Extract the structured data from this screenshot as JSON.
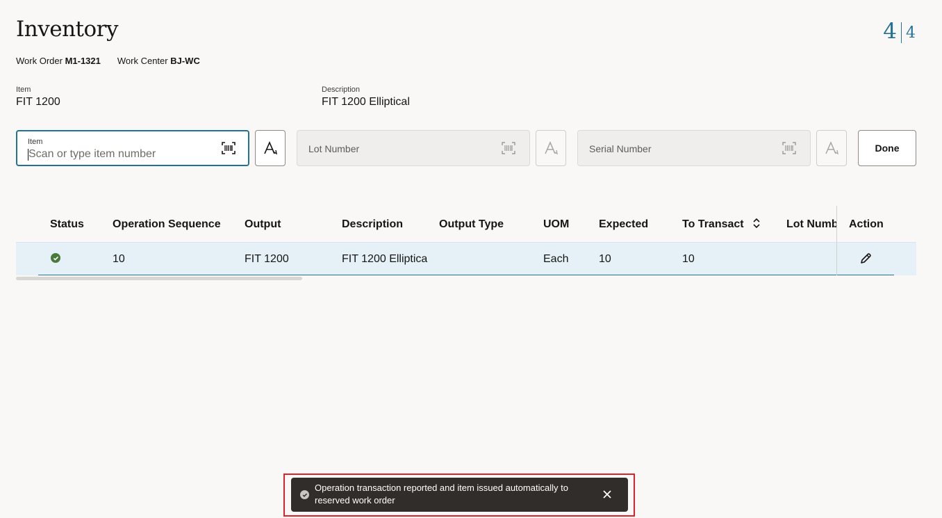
{
  "header": {
    "title": "Inventory",
    "counter_current": "4",
    "counter_total": "4"
  },
  "work_order": {
    "label": "Work Order",
    "value": "M1-1321",
    "center_label": "Work Center",
    "center_value": "BJ-WC"
  },
  "item_info": {
    "item_label": "Item",
    "item_value": "FIT 1200",
    "desc_label": "Description",
    "desc_value": "FIT 1200 Elliptical"
  },
  "inputs": {
    "item_label": "Item",
    "item_placeholder": "Scan or type item number",
    "lot_placeholder": "Lot Number",
    "serial_placeholder": "Serial Number",
    "done_label": "Done"
  },
  "table": {
    "columns": [
      "Status",
      "Operation Sequence",
      "Output",
      "Description",
      "Output Type",
      "UOM",
      "Expected",
      "To Transact",
      "Lot Numb",
      "Action"
    ],
    "rows": [
      {
        "status": "complete",
        "op_seq": "10",
        "output": "FIT 1200",
        "description": "FIT 1200 Elliptica",
        "output_type": "",
        "uom": "Each",
        "expected": "10",
        "to_transact": "10",
        "lot": ""
      }
    ]
  },
  "toast": {
    "message": "Operation transaction reported and item issued automatically to reserved work order",
    "highlight_color": "#e0202a"
  },
  "colors": {
    "accent": "#227199",
    "toast_bg": "#312d2a",
    "row_selected": "#e5f1f7",
    "status_ok": "#4a7a3a"
  }
}
